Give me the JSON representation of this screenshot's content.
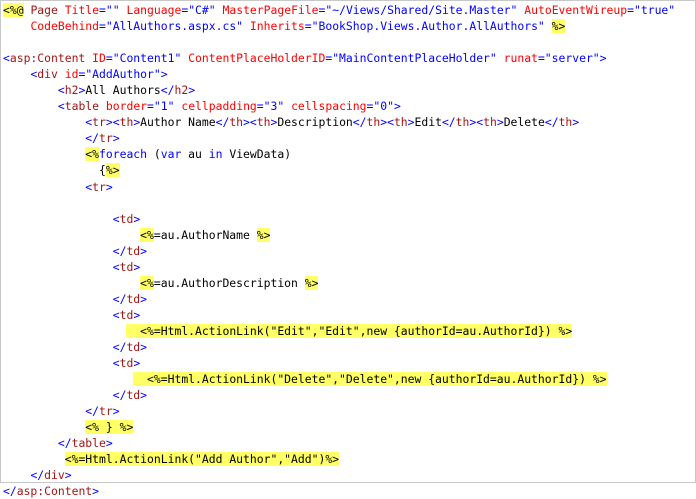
{
  "colors": {
    "background": "#ffffff",
    "tag": "#a31515",
    "attribute": "#ff0000",
    "value": "#0000ff",
    "delimiter": "#0000ff",
    "keyword": "#0000ff",
    "highlight": "#ffff66",
    "text": "#000000"
  },
  "code": {
    "lines": [
      [
        [
          "hl",
          "<%@"
        ],
        [
          "p",
          " "
        ],
        [
          "tag",
          "Page"
        ],
        [
          "p",
          " "
        ],
        [
          "attr",
          "Title"
        ],
        [
          "delim",
          "="
        ],
        [
          "val",
          "\"\""
        ],
        [
          "p",
          " "
        ],
        [
          "attr",
          "Language"
        ],
        [
          "delim",
          "="
        ],
        [
          "val",
          "\"C#\""
        ],
        [
          "p",
          " "
        ],
        [
          "attr",
          "MasterPageFile"
        ],
        [
          "delim",
          "="
        ],
        [
          "val",
          "\"~/Views/Shared/Site.Master\""
        ],
        [
          "p",
          " "
        ],
        [
          "attr",
          "AutoEventWireup"
        ],
        [
          "delim",
          "="
        ],
        [
          "val",
          "\"true\""
        ]
      ],
      [
        [
          "p",
          "    "
        ],
        [
          "attr",
          "CodeBehind"
        ],
        [
          "delim",
          "="
        ],
        [
          "val",
          "\"AllAuthors.aspx.cs\""
        ],
        [
          "p",
          " "
        ],
        [
          "attr",
          "Inherits"
        ],
        [
          "delim",
          "="
        ],
        [
          "val",
          "\"BookShop.Views.Author.AllAuthors\""
        ],
        [
          "p",
          " "
        ],
        [
          "hl",
          "%>"
        ]
      ],
      [
        [
          "p",
          ""
        ]
      ],
      [
        [
          "delim",
          "<"
        ],
        [
          "tag",
          "asp:Content"
        ],
        [
          "p",
          " "
        ],
        [
          "attr",
          "ID"
        ],
        [
          "delim",
          "="
        ],
        [
          "val",
          "\"Content1\""
        ],
        [
          "p",
          " "
        ],
        [
          "attr",
          "ContentPlaceHolderID"
        ],
        [
          "delim",
          "="
        ],
        [
          "val",
          "\"MainContentPlaceHolder\""
        ],
        [
          "p",
          " "
        ],
        [
          "attr",
          "runat"
        ],
        [
          "delim",
          "="
        ],
        [
          "val",
          "\"server\""
        ],
        [
          "delim",
          ">"
        ]
      ],
      [
        [
          "p",
          "    "
        ],
        [
          "delim",
          "<"
        ],
        [
          "tag",
          "div"
        ],
        [
          "p",
          " "
        ],
        [
          "attr",
          "id"
        ],
        [
          "delim",
          "="
        ],
        [
          "val",
          "\"AddAuthor\""
        ],
        [
          "delim",
          ">"
        ]
      ],
      [
        [
          "p",
          "        "
        ],
        [
          "delim",
          "<"
        ],
        [
          "tag",
          "h2"
        ],
        [
          "delim",
          ">"
        ],
        [
          "p",
          "All Authors"
        ],
        [
          "delim",
          "</"
        ],
        [
          "tag",
          "h2"
        ],
        [
          "delim",
          ">"
        ]
      ],
      [
        [
          "p",
          "        "
        ],
        [
          "delim",
          "<"
        ],
        [
          "tag",
          "table"
        ],
        [
          "p",
          " "
        ],
        [
          "attr",
          "border"
        ],
        [
          "delim",
          "="
        ],
        [
          "val",
          "\"1\""
        ],
        [
          "p",
          " "
        ],
        [
          "attr",
          "cellpadding"
        ],
        [
          "delim",
          "="
        ],
        [
          "val",
          "\"3\""
        ],
        [
          "p",
          " "
        ],
        [
          "attr",
          "cellspacing"
        ],
        [
          "delim",
          "="
        ],
        [
          "val",
          "\"0\""
        ],
        [
          "delim",
          ">"
        ]
      ],
      [
        [
          "p",
          "            "
        ],
        [
          "delim",
          "<"
        ],
        [
          "tag",
          "tr"
        ],
        [
          "delim",
          "><"
        ],
        [
          "tag",
          "th"
        ],
        [
          "delim",
          ">"
        ],
        [
          "p",
          "Author Name"
        ],
        [
          "delim",
          "</"
        ],
        [
          "tag",
          "th"
        ],
        [
          "delim",
          "><"
        ],
        [
          "tag",
          "th"
        ],
        [
          "delim",
          ">"
        ],
        [
          "p",
          "Description"
        ],
        [
          "delim",
          "</"
        ],
        [
          "tag",
          "th"
        ],
        [
          "delim",
          "><"
        ],
        [
          "tag",
          "th"
        ],
        [
          "delim",
          ">"
        ],
        [
          "p",
          "Edit"
        ],
        [
          "delim",
          "</"
        ],
        [
          "tag",
          "th"
        ],
        [
          "delim",
          "><"
        ],
        [
          "tag",
          "th"
        ],
        [
          "delim",
          ">"
        ],
        [
          "p",
          "Delete"
        ],
        [
          "delim",
          "</"
        ],
        [
          "tag",
          "th"
        ],
        [
          "delim",
          ">"
        ]
      ],
      [
        [
          "p",
          "            "
        ],
        [
          "delim",
          "</"
        ],
        [
          "tag",
          "tr"
        ],
        [
          "delim",
          ">"
        ]
      ],
      [
        [
          "p",
          "            "
        ],
        [
          "hl",
          "<%"
        ],
        [
          "kw",
          "foreach"
        ],
        [
          "p",
          " ("
        ],
        [
          "kw",
          "var"
        ],
        [
          "p",
          " au "
        ],
        [
          "kw",
          "in"
        ],
        [
          "p",
          " ViewData)"
        ]
      ],
      [
        [
          "p",
          "              {"
        ],
        [
          "hl",
          "%>"
        ]
      ],
      [
        [
          "p",
          "            "
        ],
        [
          "delim",
          "<"
        ],
        [
          "tag",
          "tr"
        ],
        [
          "delim",
          ">"
        ]
      ],
      [
        [
          "p",
          ""
        ]
      ],
      [
        [
          "p",
          "                "
        ],
        [
          "delim",
          "<"
        ],
        [
          "tag",
          "td"
        ],
        [
          "delim",
          ">"
        ]
      ],
      [
        [
          "p",
          "                    "
        ],
        [
          "hl",
          "<%"
        ],
        [
          "p",
          "=au.AuthorName "
        ],
        [
          "hl",
          "%>"
        ]
      ],
      [
        [
          "p",
          "                "
        ],
        [
          "delim",
          "</"
        ],
        [
          "tag",
          "td"
        ],
        [
          "delim",
          ">"
        ]
      ],
      [
        [
          "p",
          "                "
        ],
        [
          "delim",
          "<"
        ],
        [
          "tag",
          "td"
        ],
        [
          "delim",
          ">"
        ]
      ],
      [
        [
          "p",
          "                    "
        ],
        [
          "hl",
          "<%"
        ],
        [
          "p",
          "=au.AuthorDescription "
        ],
        [
          "hl",
          "%>"
        ]
      ],
      [
        [
          "p",
          "                "
        ],
        [
          "delim",
          "</"
        ],
        [
          "tag",
          "td"
        ],
        [
          "delim",
          ">"
        ]
      ],
      [
        [
          "p",
          "                "
        ],
        [
          "delim",
          "<"
        ],
        [
          "tag",
          "td"
        ],
        [
          "delim",
          ">"
        ]
      ],
      [
        [
          "p",
          "                  "
        ],
        [
          "hl",
          "  <%=Html.ActionLink(\"Edit\",\"Edit\",new {authorId=au.AuthorId}) %>"
        ]
      ],
      [
        [
          "p",
          "                "
        ],
        [
          "delim",
          "</"
        ],
        [
          "tag",
          "td"
        ],
        [
          "delim",
          ">"
        ]
      ],
      [
        [
          "p",
          "                "
        ],
        [
          "delim",
          "<"
        ],
        [
          "tag",
          "td"
        ],
        [
          "delim",
          ">"
        ]
      ],
      [
        [
          "p",
          "                   "
        ],
        [
          "hl",
          "  <%=Html.ActionLink(\"Delete\",\"Delete\",new {authorId=au.AuthorId}) %>"
        ]
      ],
      [
        [
          "p",
          "                "
        ],
        [
          "delim",
          "</"
        ],
        [
          "tag",
          "td"
        ],
        [
          "delim",
          ">"
        ]
      ],
      [
        [
          "p",
          "            "
        ],
        [
          "delim",
          "</"
        ],
        [
          "tag",
          "tr"
        ],
        [
          "delim",
          ">"
        ]
      ],
      [
        [
          "p",
          "            "
        ],
        [
          "hl",
          "<% } %>"
        ]
      ],
      [
        [
          "p",
          "        "
        ],
        [
          "delim",
          "</"
        ],
        [
          "tag",
          "table"
        ],
        [
          "delim",
          ">"
        ]
      ],
      [
        [
          "p",
          "         "
        ],
        [
          "hl",
          "<%=Html.ActionLink(\"Add Author\",\"Add\")%>"
        ]
      ],
      [
        [
          "p",
          "    "
        ],
        [
          "delim",
          "</"
        ],
        [
          "tag",
          "div"
        ],
        [
          "delim",
          ">"
        ]
      ],
      [
        [
          "delim",
          "</"
        ],
        [
          "tag",
          "asp:Content"
        ],
        [
          "delim",
          ">"
        ]
      ]
    ]
  }
}
